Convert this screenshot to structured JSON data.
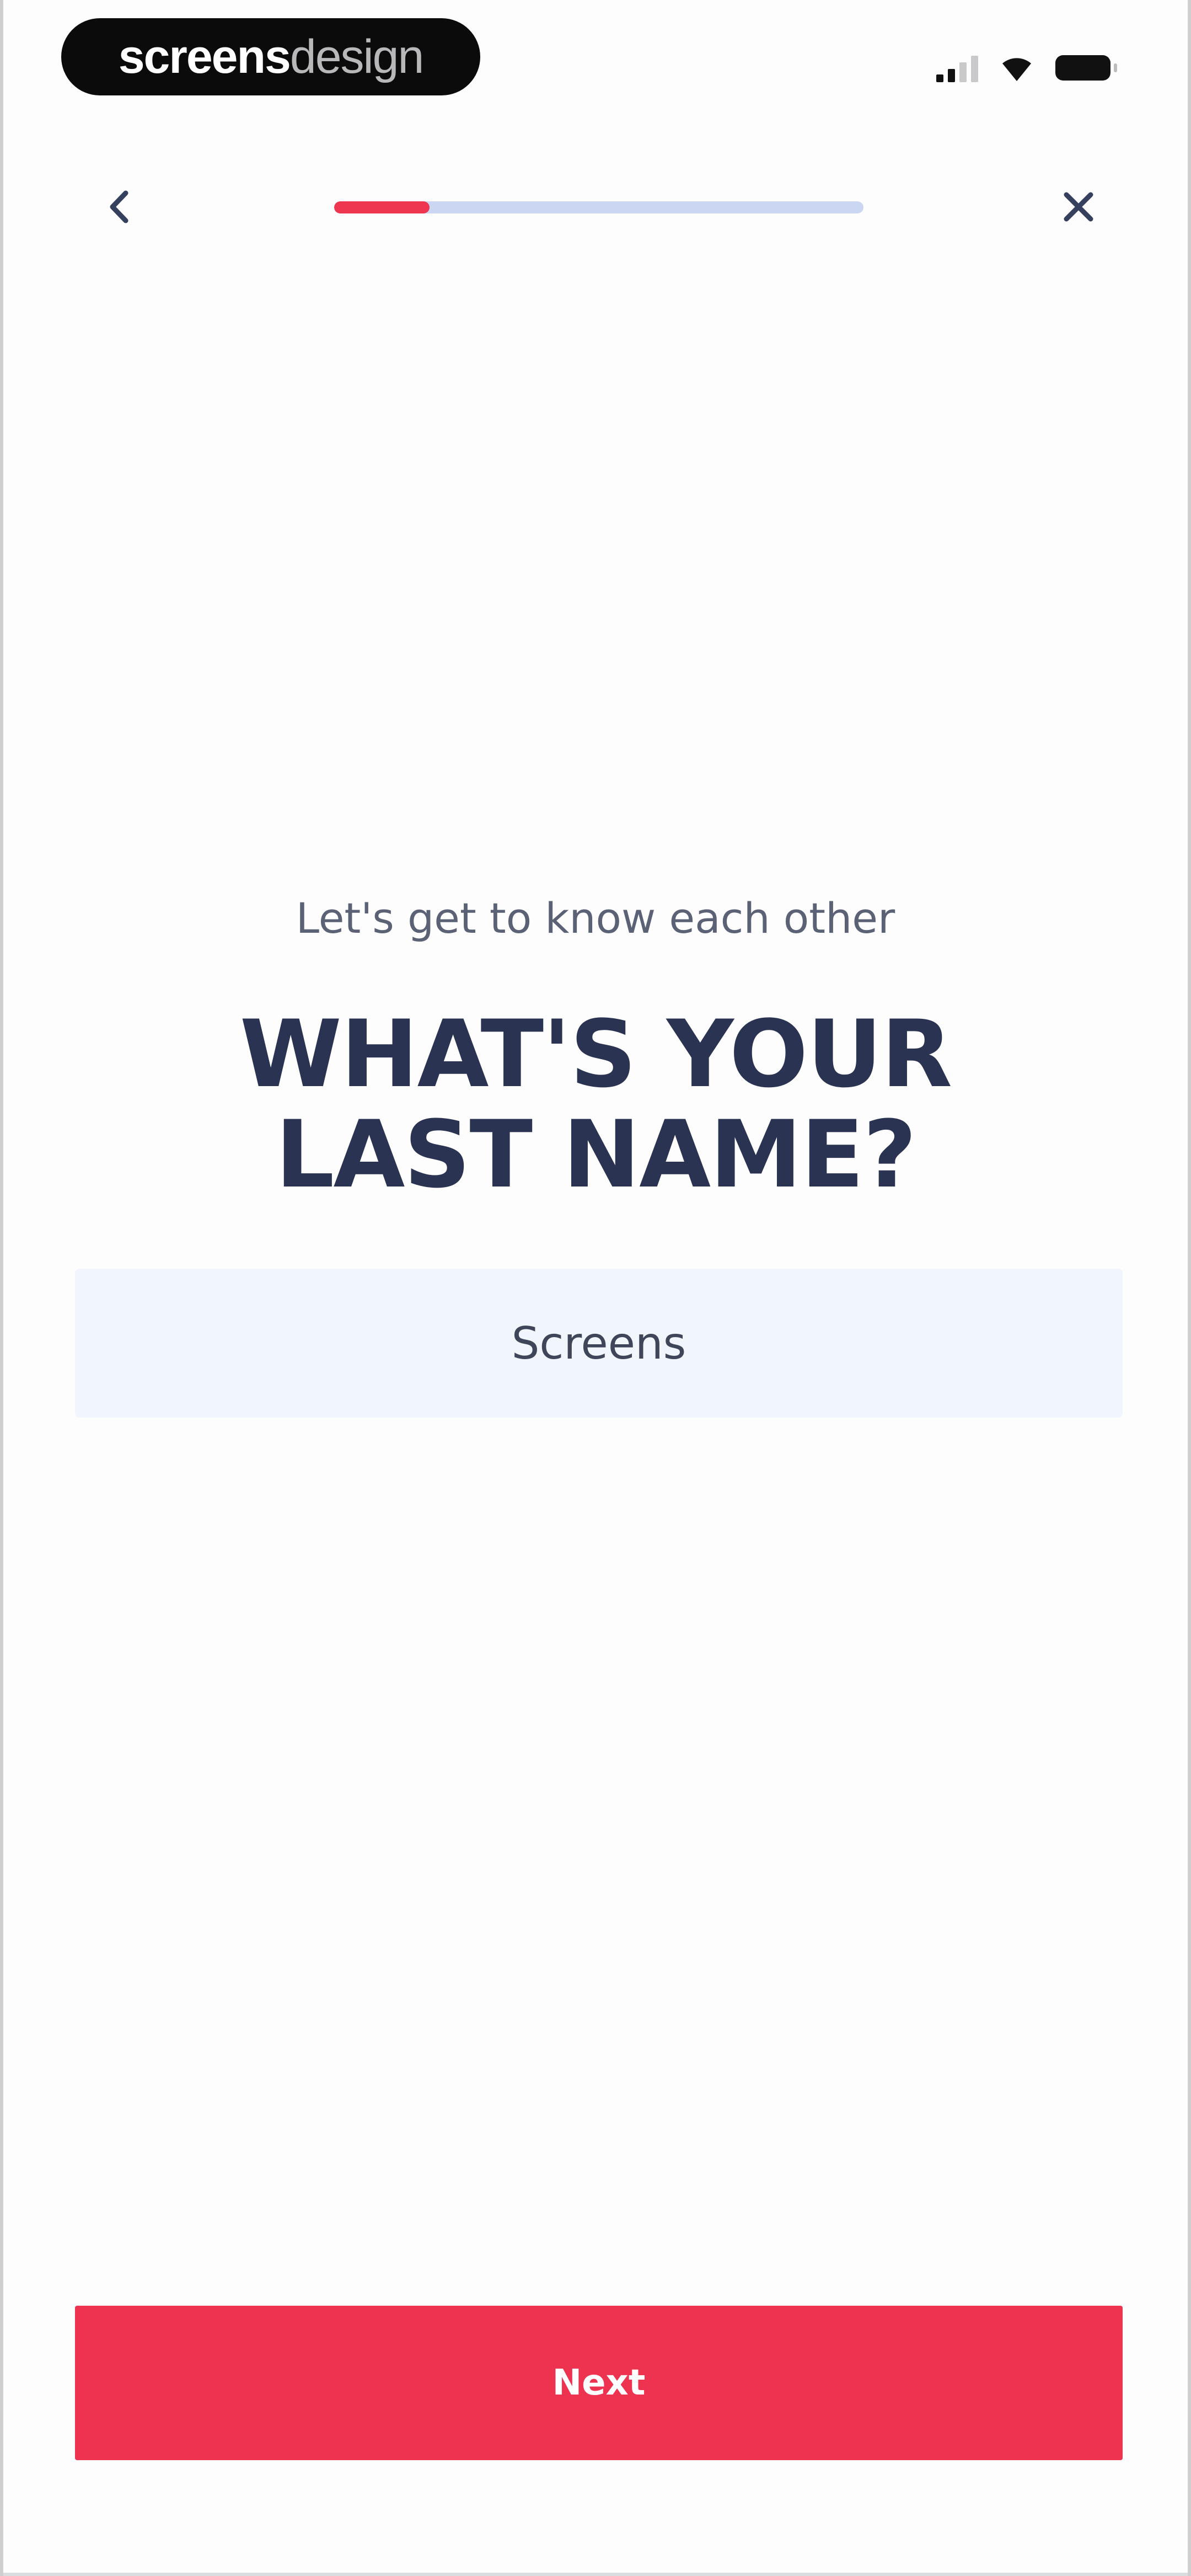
{
  "status_bar": {
    "brand_bold": "screens",
    "brand_light": "design",
    "signal_icon": "signal-icon",
    "wifi_icon": "wifi-icon",
    "battery_icon": "battery-icon"
  },
  "nav": {
    "back_icon": "chevron-left-icon",
    "close_icon": "close-icon",
    "progress": 0.18,
    "colors": {
      "progress_fill": "#ee3650",
      "progress_track": "#cbd7f2"
    }
  },
  "content": {
    "subtitle": "Let's get to know each other",
    "title": "WHAT'S YOUR LAST NAME?",
    "input_value": "Screens"
  },
  "actions": {
    "next_label": "Next",
    "next_color": "#ee3350"
  }
}
